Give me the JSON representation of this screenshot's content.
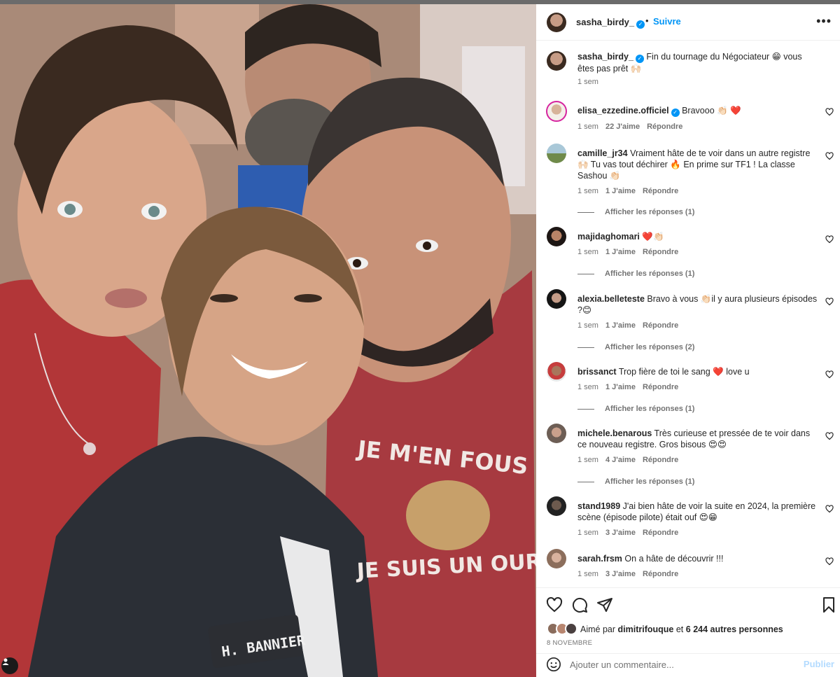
{
  "post": {
    "author": "sasha_birdy_",
    "follow_label": "Suivre",
    "separator": "•",
    "caption": "Fin du tournage du Négociateur 😁 vous êtes pas prêt 🙌🏻",
    "caption_time": "1 sem",
    "photo_text": {
      "shirt_line1": "JE M'EN FOUS",
      "shirt_line2": "JE SUIS UN OURS",
      "patch": "H. BANNIER"
    }
  },
  "comments": [
    {
      "user": "elisa_ezzedine.officiel",
      "verified": true,
      "text": "Bravooo 👏🏻 ❤️",
      "time": "1 sem",
      "likes": "22 J'aime",
      "reply": "Répondre",
      "replies": ""
    },
    {
      "user": "camille_jr34",
      "verified": false,
      "text": "Vraiment hâte de te voir dans un autre registre 🙌🏻 Tu vas tout déchirer 🔥 En prime sur TF1 ! La classe Sashou 👏🏻",
      "time": "1 sem",
      "likes": "1 J'aime",
      "reply": "Répondre",
      "replies": "Afficher les réponses (1)"
    },
    {
      "user": "majidaghomari",
      "verified": false,
      "text": "❤️👏🏻",
      "time": "1 sem",
      "likes": "1 J'aime",
      "reply": "Répondre",
      "replies": "Afficher les réponses (1)"
    },
    {
      "user": "alexia.belleteste",
      "verified": false,
      "text": "Bravo à vous 👏🏻il y aura plusieurs épisodes ?😊",
      "time": "1 sem",
      "likes": "1 J'aime",
      "reply": "Répondre",
      "replies": "Afficher les réponses (2)"
    },
    {
      "user": "brissanct",
      "verified": false,
      "text": "Trop fière de toi le sang ❤️ love u",
      "time": "1 sem",
      "likes": "1 J'aime",
      "reply": "Répondre",
      "replies": "Afficher les réponses (1)"
    },
    {
      "user": "michele.benarous",
      "verified": false,
      "text": "Très curieuse et pressée de te voir dans ce nouveau registre. Gros bisous 😍😍",
      "time": "1 sem",
      "likes": "4 J'aime",
      "reply": "Répondre",
      "replies": "Afficher les réponses (1)"
    },
    {
      "user": "stand1989",
      "verified": false,
      "text": "J'ai bien hâte de voir la suite en 2024, la première scène (épisode pilote) était ouf 😍😁",
      "time": "1 sem",
      "likes": "3 J'aime",
      "reply": "Répondre",
      "replies": ""
    },
    {
      "user": "sarah.frsm",
      "verified": false,
      "text": "On a hâte de découvrir !!!",
      "time": "1 sem",
      "likes": "3 J'aime",
      "reply": "Répondre",
      "replies": ""
    }
  ],
  "footer": {
    "liked_prefix": "Aimé par",
    "liked_user": "dimitrifouque",
    "liked_and": "et",
    "liked_others": "6 244 autres personnes",
    "date": "8 NOVEMBRE",
    "comment_placeholder": "Ajouter un commentaire...",
    "publish_label": "Publier"
  },
  "colors": {
    "accent": "#0095f6",
    "meta_gray": "#737373",
    "text": "#262626",
    "publish_disabled": "#b3dbff"
  },
  "icons": {
    "header_more": "more-horizontal-icon",
    "like": "heart-outline-icon",
    "comment": "comment-bubble-icon",
    "share": "paper-plane-icon",
    "save": "bookmark-icon",
    "emoji": "smiley-icon",
    "verified": "verified-badge-icon",
    "photo_tags": "tagged-user-icon"
  }
}
